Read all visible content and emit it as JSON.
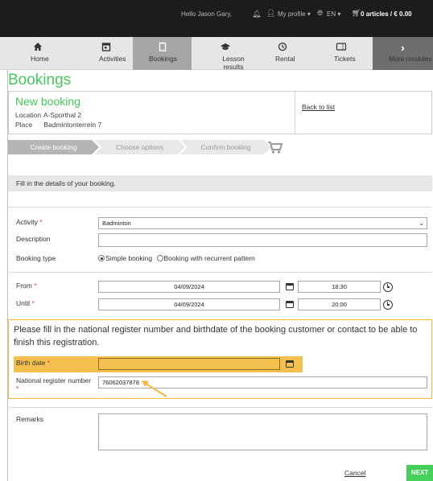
{
  "topbar": {
    "greeting": "Hello Jason Gary,",
    "profile": "My profile ▾",
    "language": "EN ▾",
    "cart": "0 articles / € 0.00"
  },
  "nav": [
    {
      "label": "Home",
      "icon": "home-icon"
    },
    {
      "label": "Activities",
      "icon": "calendar-icon"
    },
    {
      "label": "Bookings",
      "icon": "clipboard-icon"
    },
    {
      "label": "Lesson results",
      "icon": "graduation-cap-icon"
    },
    {
      "label": "Rental",
      "icon": "history-icon"
    },
    {
      "label": "Tickets",
      "icon": "ticket-icon"
    },
    {
      "label": "More modules",
      "icon": "chevron-right-icon"
    }
  ],
  "page": {
    "title": "Bookings",
    "new_booking": "New booking",
    "location_label": "Location",
    "location_value": "A-Sporthal 2",
    "place_label": "Place",
    "place_value": "Badmintonterrein 7",
    "back_link": "Back to list"
  },
  "steps": [
    "Create booking",
    "Choose options",
    "Confirm booking"
  ],
  "info": "Fill in the details of your booking.",
  "form": {
    "activity_label": "Activity",
    "activity_value": "Badminton",
    "description_label": "Description",
    "description_value": "",
    "booking_type_label": "Booking type",
    "booking_type_simple": "Simple booking",
    "booking_type_recurrent": "Booking with recurrent pattern",
    "from_label": "From",
    "from_date": "04/09/2024",
    "from_time": "18:30",
    "until_label": "Until",
    "until_date": "04/09/2024",
    "until_time": "20:00",
    "notice": "Please fill in the national register number and birthdate of the booking customer or contact to be able to finish this registration.",
    "birth_label": "Birth date",
    "birth_value": "",
    "national_label": "National register number",
    "national_value": "76062037878",
    "remarks_label": "Remarks",
    "remarks_value": "",
    "required_mark": "*"
  },
  "buttons": {
    "cancel": "Cancel",
    "next": "NEXT"
  },
  "colors": {
    "accent_green": "#45c85a",
    "highlight": "#f5c04e",
    "notice_border": "#f5b942",
    "topbar": "#1c1c1c"
  }
}
